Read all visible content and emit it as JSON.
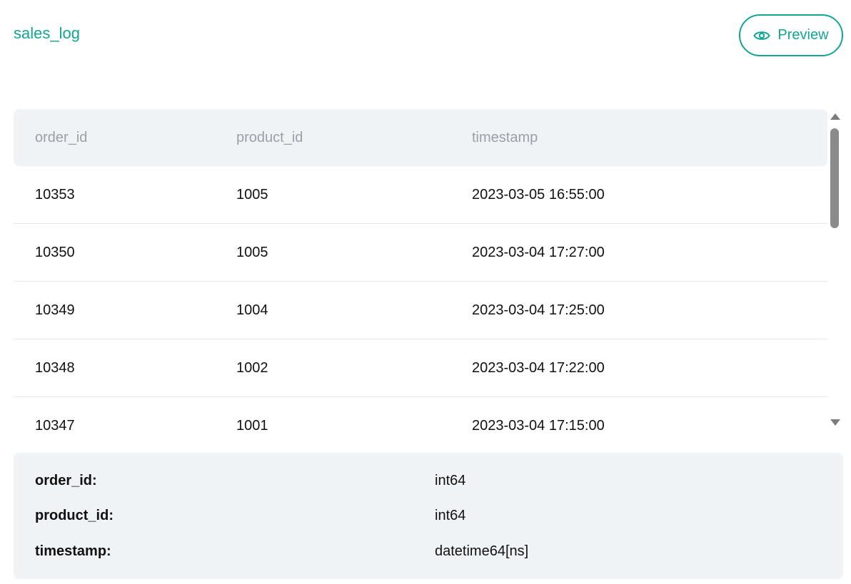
{
  "header": {
    "title": "sales_log",
    "preview_label": "Preview"
  },
  "table": {
    "columns": [
      "order_id",
      "product_id",
      "timestamp"
    ],
    "rows": [
      [
        "10353",
        "1005",
        "2023-03-05 16:55:00"
      ],
      [
        "10350",
        "1005",
        "2023-03-04 17:27:00"
      ],
      [
        "10349",
        "1004",
        "2023-03-04 17:25:00"
      ],
      [
        "10348",
        "1002",
        "2023-03-04 17:22:00"
      ],
      [
        "10347",
        "1001",
        "2023-03-04 17:15:00"
      ]
    ]
  },
  "schema": {
    "fields": [
      {
        "name": "order_id:",
        "dtype": "int64"
      },
      {
        "name": "product_id:",
        "dtype": "int64"
      },
      {
        "name": "timestamp:",
        "dtype": "datetime64[ns]"
      }
    ]
  },
  "colors": {
    "accent": "#11a693",
    "panel_bg": "#f0f3f6",
    "header_text": "#9aa0a8"
  },
  "icons": {
    "preview": "eye-icon"
  }
}
